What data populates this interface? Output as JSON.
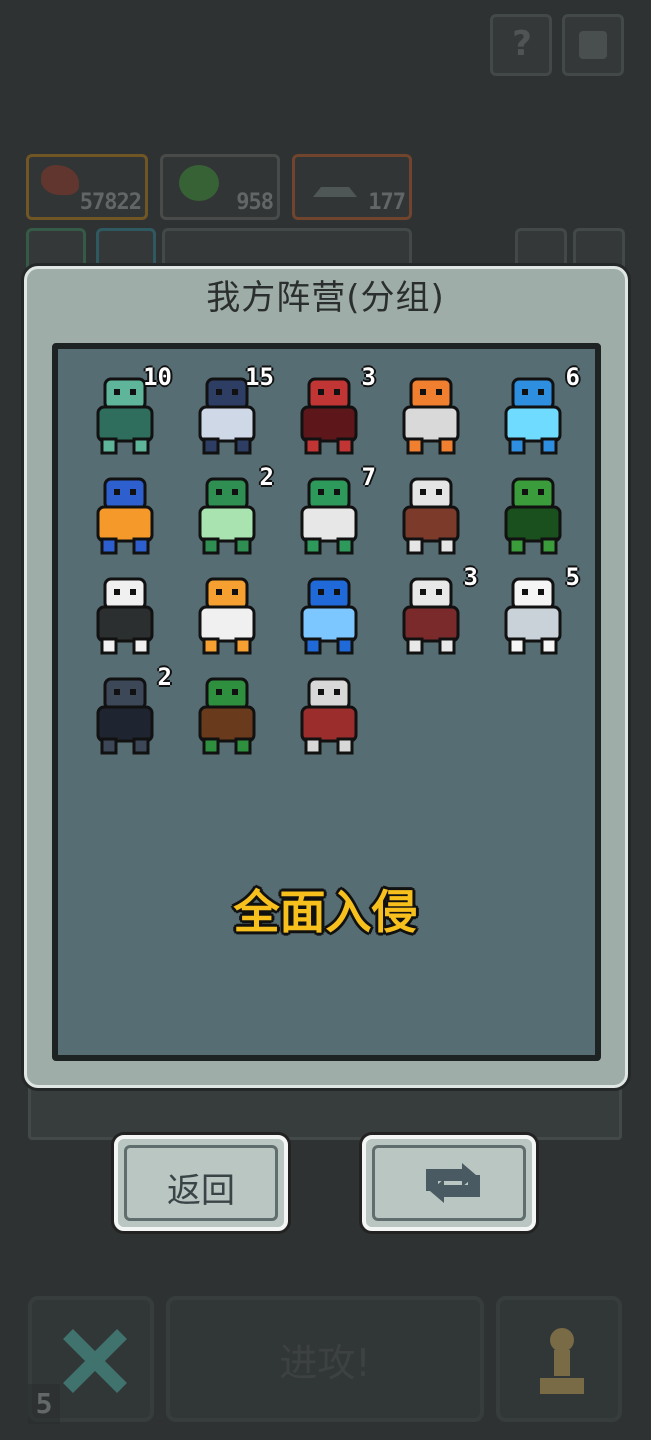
{
  "hud": {
    "resources": [
      {
        "name": "meat",
        "value": "57822",
        "color": "#a8741c"
      },
      {
        "name": "gems",
        "value": "958",
        "color": "#5f6060"
      },
      {
        "name": "ships",
        "value": "177",
        "color": "#a6542a"
      }
    ]
  },
  "modal": {
    "title": "我方阵营(分组)",
    "units": [
      {
        "name": "zombie",
        "count": "10",
        "colors": [
          "#5fb59a",
          "#2f6d5c"
        ]
      },
      {
        "name": "shark",
        "count": "15",
        "colors": [
          "#2d3d64",
          "#cfd8e6"
        ]
      },
      {
        "name": "red-dragon",
        "count": "3",
        "colors": [
          "#c23535",
          "#5d1619"
        ]
      },
      {
        "name": "fire-imp",
        "count": "",
        "colors": [
          "#f07f2f",
          "#d9d9d9"
        ]
      },
      {
        "name": "ice-golem",
        "count": "6",
        "colors": [
          "#2e8fe0",
          "#6fdcff"
        ]
      },
      {
        "name": "sea-knight",
        "count": "",
        "colors": [
          "#2d5fcf",
          "#f59a2a"
        ]
      },
      {
        "name": "cactus-snake",
        "count": "2",
        "colors": [
          "#2f8f53",
          "#a8e3b0"
        ]
      },
      {
        "name": "lizard-mage",
        "count": "7",
        "colors": [
          "#2d9a5c",
          "#e7e7e7"
        ]
      },
      {
        "name": "skull-lancer",
        "count": "",
        "colors": [
          "#e5e5e5",
          "#7c3a2a"
        ]
      },
      {
        "name": "treant",
        "count": "",
        "colors": [
          "#3a9c3a",
          "#1a4f1e"
        ]
      },
      {
        "name": "witch",
        "count": "",
        "colors": [
          "#f0f0f0",
          "#2b2f30"
        ]
      },
      {
        "name": "sun-king",
        "count": "",
        "colors": [
          "#f5a030",
          "#f0f0f0"
        ]
      },
      {
        "name": "portal",
        "count": "",
        "colors": [
          "#1f6ad8",
          "#7cc7ff"
        ]
      },
      {
        "name": "dark-knight",
        "count": "3",
        "colors": [
          "#e8e8e8",
          "#7a2a2a"
        ]
      },
      {
        "name": "yeti",
        "count": "5",
        "colors": [
          "#f5f5f5",
          "#c9d2d8"
        ]
      },
      {
        "name": "spider-beast",
        "count": "2",
        "colors": [
          "#3c4758",
          "#1e2530"
        ]
      },
      {
        "name": "minotaur",
        "count": "",
        "colors": [
          "#2e8f3e",
          "#6a3a1c"
        ]
      },
      {
        "name": "paladin",
        "count": "",
        "colors": [
          "#d8d8d8",
          "#9c2d2d"
        ]
      }
    ],
    "invade_label": "全面入侵"
  },
  "buttons": {
    "back_label": "返回",
    "swap_icon": "swap-icon",
    "attack_label": "进攻!",
    "cancel_icon": "x-icon",
    "pawn_icon": "pawn-icon",
    "corner_counter": "5"
  }
}
